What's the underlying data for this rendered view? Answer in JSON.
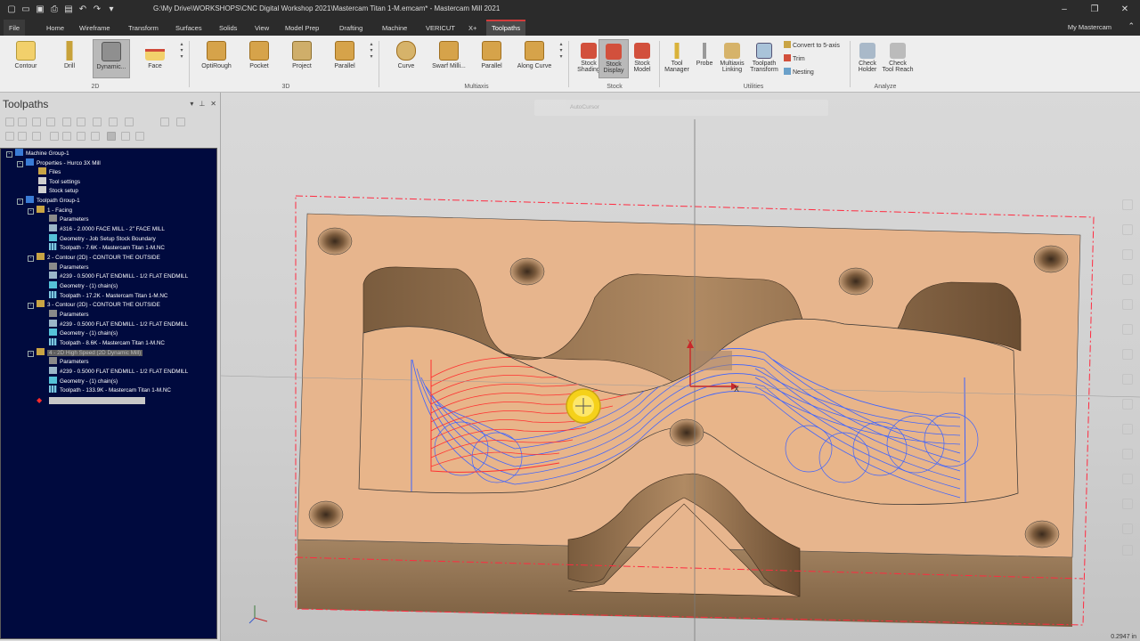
{
  "window": {
    "title": "G:\\My Drive\\WORKSHOPS\\CNC Digital Workshop 2021\\Mastercam Titan 1-M.emcam* - Mastercam Mill 2021"
  },
  "menu": {
    "tabs": [
      "File",
      "Home",
      "Wireframe",
      "Transform",
      "Surfaces",
      "Solids",
      "View",
      "Model Prep",
      "Drafting",
      "Machine",
      "VERICUT",
      "X+",
      "Toolpaths"
    ],
    "active": "Toolpaths",
    "account": "My Mastercam"
  },
  "ribbon": {
    "g2d": {
      "label": "2D",
      "buttons": [
        "Contour",
        "Drill",
        "Dynamic...",
        "Face"
      ]
    },
    "g3d": {
      "label": "3D",
      "buttons": [
        "OptiRough",
        "Pocket",
        "Project",
        "Parallel"
      ]
    },
    "multiaxis": {
      "label": "Multiaxis",
      "buttons": [
        "Curve",
        "Swarf Milli...",
        "Parallel",
        "Along Curve"
      ]
    },
    "stock": {
      "label": "Stock",
      "buttons": [
        {
          "line1": "Stock",
          "line2": "Shading"
        },
        {
          "line1": "Stock",
          "line2": "Display"
        },
        {
          "line1": "Stock",
          "line2": "Model"
        }
      ]
    },
    "utilities": {
      "label": "Utilities",
      "buttons": [
        {
          "line1": "Tool",
          "line2": "Manager"
        },
        {
          "line1": "Probe",
          "line2": ""
        },
        {
          "line1": "Multiaxis",
          "line2": "Linking"
        },
        {
          "line1": "Toolpath",
          "line2": "Transform"
        }
      ],
      "small": [
        "Convert to 5-axis",
        "Trim",
        "Nesting"
      ]
    },
    "analyze": {
      "label": "Analyze",
      "buttons": [
        {
          "line1": "Check",
          "line2": "Holder"
        },
        {
          "line1": "Check",
          "line2": "Tool Reach"
        }
      ]
    }
  },
  "panel": {
    "title": "Toolpaths",
    "tree": [
      {
        "text": "Machine Group-1",
        "icon": "blue",
        "ex": "-"
      },
      {
        "text": "Properties - Hurco 3X Mill",
        "icon": "blue",
        "ex": "-"
      },
      {
        "text": "Files",
        "icon": "folder"
      },
      {
        "text": "Tool settings",
        "icon": "set"
      },
      {
        "text": "Stock setup",
        "icon": "set"
      },
      {
        "text": "Toolpath Group-1",
        "icon": "blue",
        "ex": "-"
      },
      {
        "text": "1 - Facing",
        "icon": "folder",
        "ex": "-"
      },
      {
        "text": "Parameters",
        "icon": "grey"
      },
      {
        "text": "#316 - 2.0000 FACE MILL - 2\" FACE MILL",
        "icon": "tool"
      },
      {
        "text": "Geometry - Job Setup Stock Boundary",
        "icon": "geo"
      },
      {
        "text": "Toolpath - 7.6K - Mastercam Titan 1-M.NC",
        "icon": "path"
      },
      {
        "text": "2 - Contour (2D) - CONTOUR THE OUTSIDE",
        "icon": "folder",
        "ex": "-"
      },
      {
        "text": "Parameters",
        "icon": "grey"
      },
      {
        "text": "#239 - 0.5000 FLAT ENDMILL - 1/2 FLAT ENDMILL",
        "icon": "tool"
      },
      {
        "text": "Geometry - (1) chain(s)",
        "icon": "geo"
      },
      {
        "text": "Toolpath - 17.2K - Mastercam Titan 1-M.NC",
        "icon": "path"
      },
      {
        "text": "3 - Contour (2D) - CONTOUR THE OUTSIDE",
        "icon": "folder",
        "ex": "-"
      },
      {
        "text": "Parameters",
        "icon": "grey"
      },
      {
        "text": "#239 - 0.5000 FLAT ENDMILL - 1/2 FLAT ENDMILL",
        "icon": "tool"
      },
      {
        "text": "Geometry - (1) chain(s)",
        "icon": "geo"
      },
      {
        "text": "Toolpath - 8.6K - Mastercam Titan 1-M.NC",
        "icon": "path"
      },
      {
        "text": "4 - 2D High Speed (2D Dynamic Mill)",
        "icon": "folder",
        "ex": "-",
        "highlight": true
      },
      {
        "text": "Parameters",
        "icon": "grey"
      },
      {
        "text": "#239 - 0.5000 FLAT ENDMILL - 1/2 FLAT ENDMILL",
        "icon": "tool"
      },
      {
        "text": "Geometry - (1) chain(s)",
        "icon": "geo"
      },
      {
        "text": "Toolpath - 133.9K - Mastercam Titan 1-M.NC",
        "icon": "path"
      }
    ]
  },
  "viewport": {
    "autocursor": "AutoCursor",
    "axis_x": "X",
    "axis_y": "Y",
    "coord_readout": "0.2947 in"
  },
  "colors": {
    "tree_bg": "#000a3e",
    "stock": "#e7b58d",
    "toolpath_blue": "#3d63ff",
    "toolpath_red": "#ff3030",
    "cursor_yellow": "#f5d11a"
  }
}
